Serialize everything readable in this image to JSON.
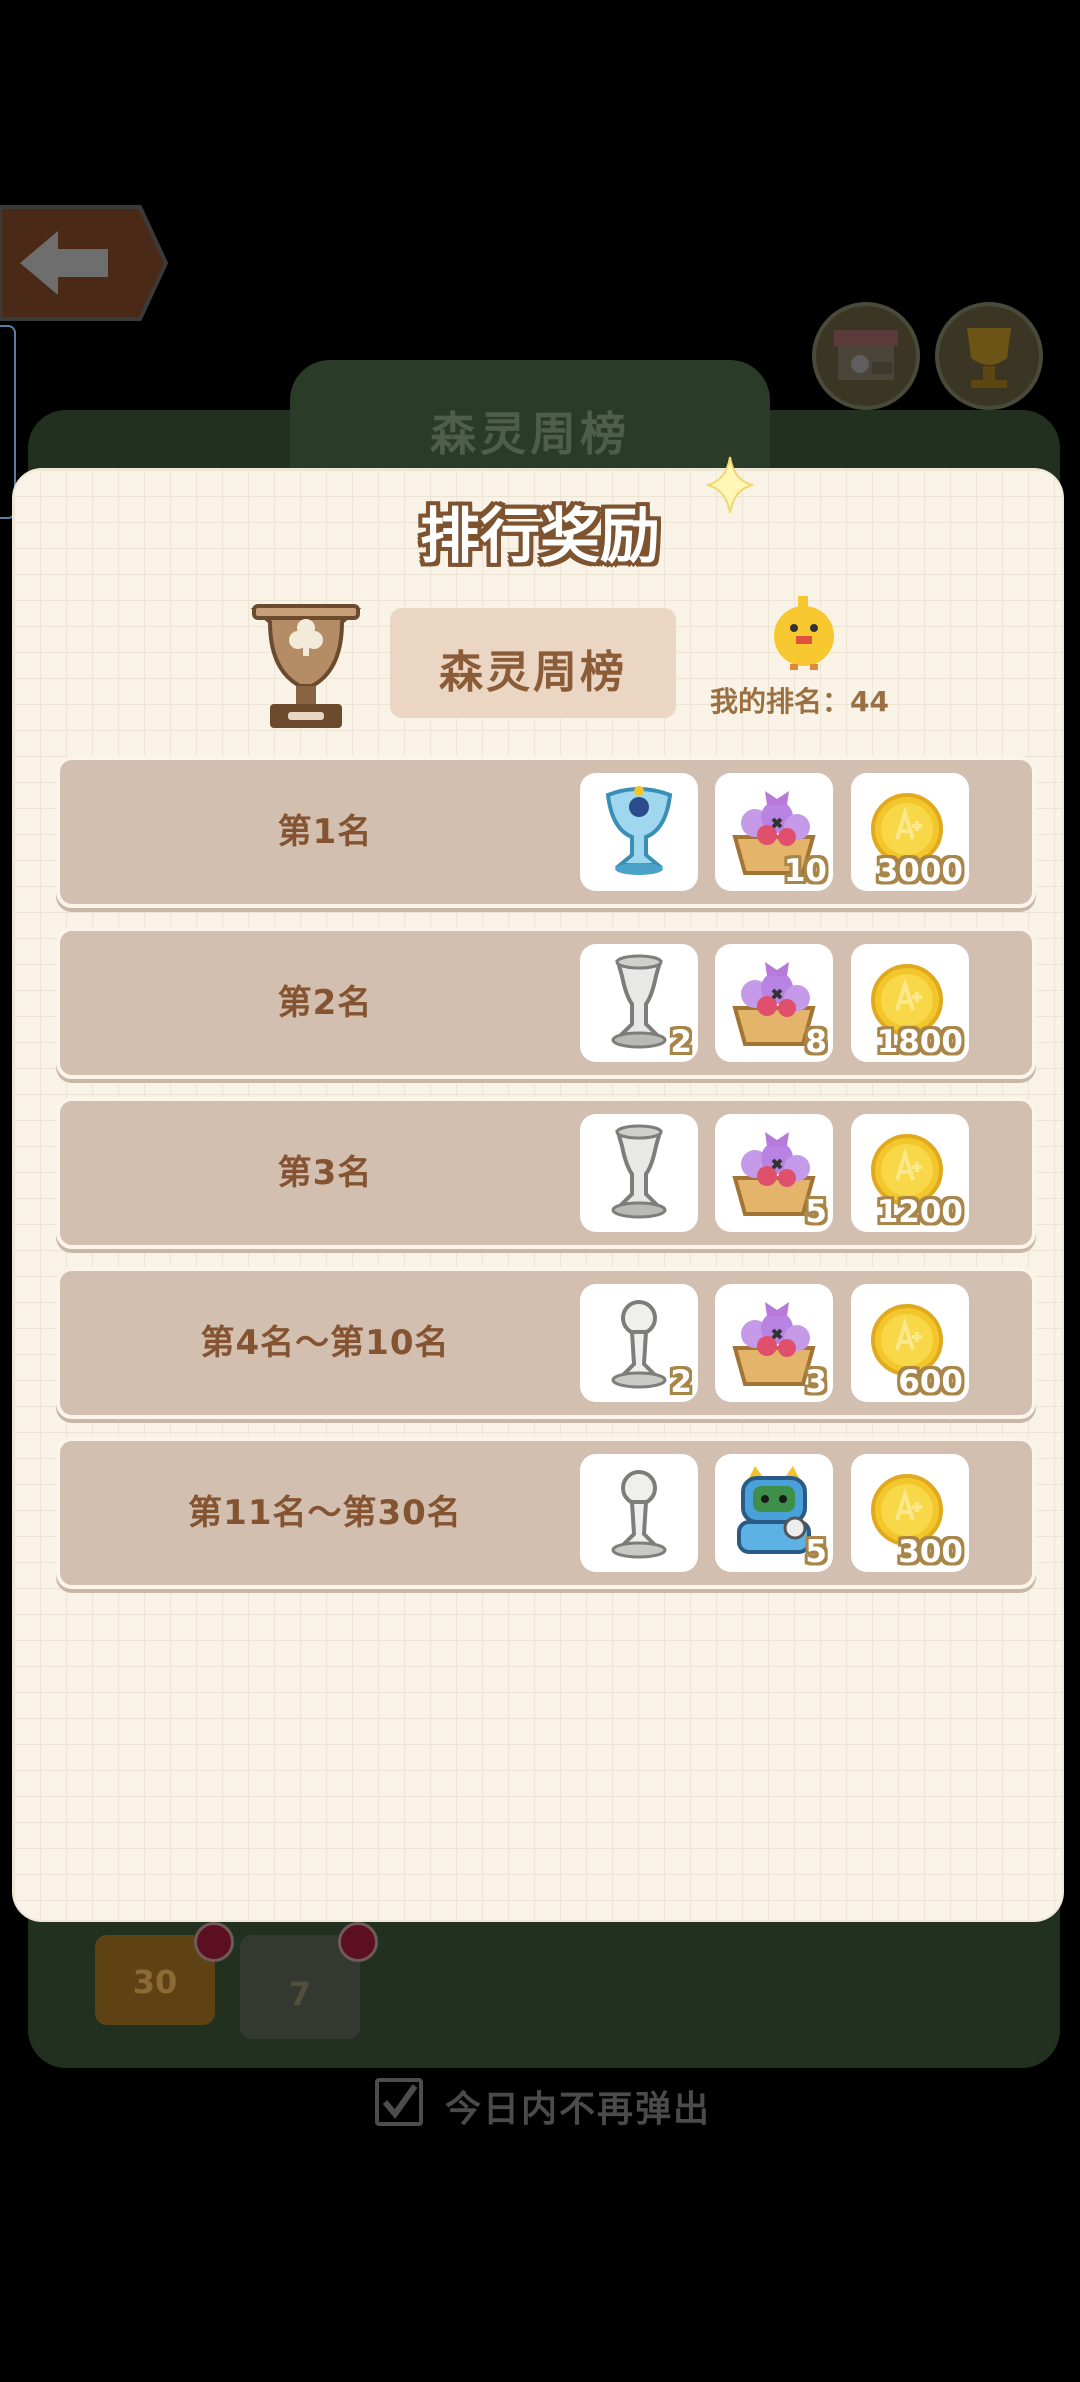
{
  "background": {
    "leaderboard_title": "森灵周榜",
    "tab_month_label": "30",
    "tab_week_label": "7",
    "dont_show_today_label": "今日内不再弹出"
  },
  "modal": {
    "title": "排行奖励",
    "board_name": "森灵周榜",
    "my_rank_label": "我的排名：44"
  },
  "rewards": [
    {
      "rank": "第1名",
      "items": [
        {
          "icon": "blue-trophy-icon",
          "qty": ""
        },
        {
          "icon": "flower-basket-icon",
          "qty": "10"
        },
        {
          "icon": "gold-coin-icon",
          "qty": "3000"
        }
      ]
    },
    {
      "rank": "第2名",
      "items": [
        {
          "icon": "silver-trophy-icon",
          "qty": "2"
        },
        {
          "icon": "flower-basket-icon",
          "qty": "8"
        },
        {
          "icon": "gold-coin-icon",
          "qty": "1800"
        }
      ]
    },
    {
      "rank": "第3名",
      "items": [
        {
          "icon": "silver-trophy-icon",
          "qty": ""
        },
        {
          "icon": "flower-basket-icon",
          "qty": "5"
        },
        {
          "icon": "gold-coin-icon",
          "qty": "1200"
        }
      ]
    },
    {
      "rank": "第4名～第10名",
      "items": [
        {
          "icon": "white-trophy-icon",
          "qty": "2"
        },
        {
          "icon": "flower-basket-icon",
          "qty": "3"
        },
        {
          "icon": "gold-coin-icon",
          "qty": "600"
        }
      ]
    },
    {
      "rank": "第11名～第30名",
      "items": [
        {
          "icon": "white-trophy-icon",
          "qty": ""
        },
        {
          "icon": "robot-cat-icon",
          "qty": "5"
        },
        {
          "icon": "gold-coin-icon",
          "qty": "300"
        }
      ]
    }
  ],
  "colors": {
    "modal_bg": "#f8f3e6",
    "row_bg": "#d2bfaf",
    "label_brown": "#845331",
    "coin_gold": "#f3c72c"
  }
}
